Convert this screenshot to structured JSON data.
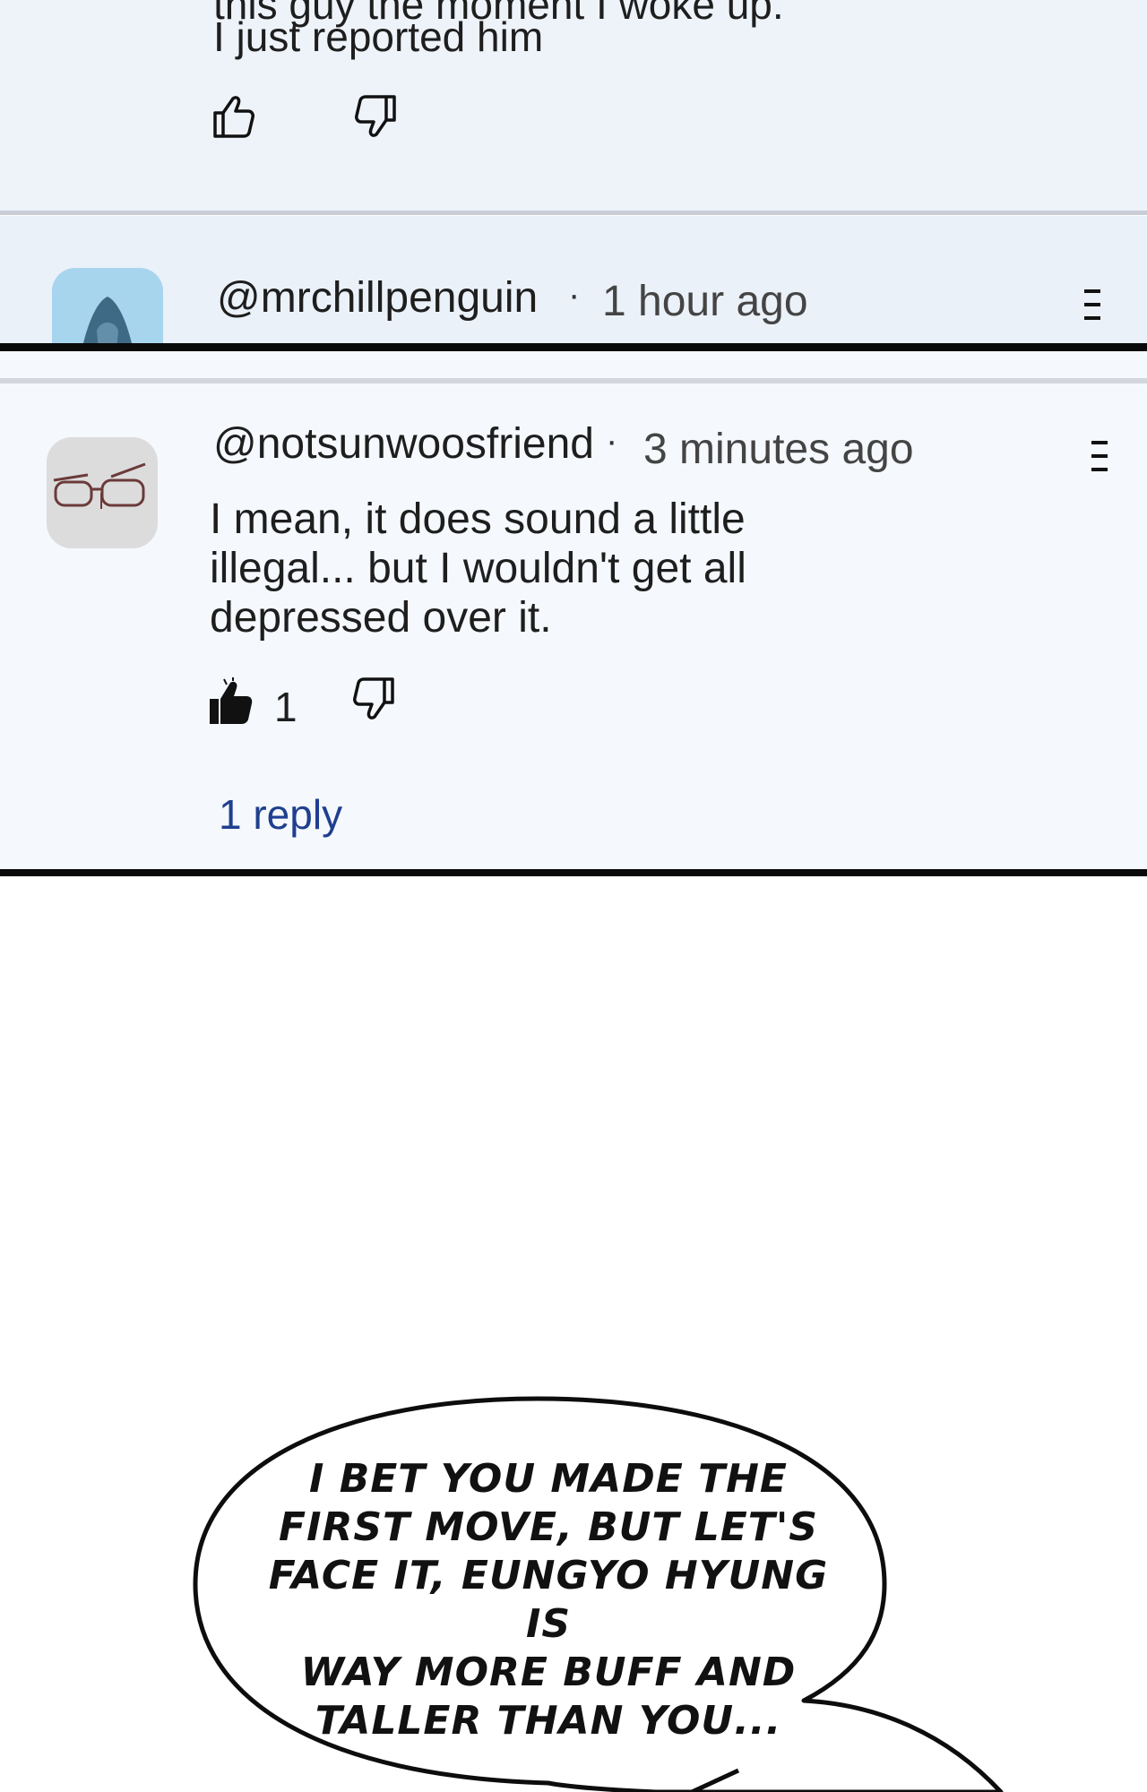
{
  "panel_top": {
    "cut_line": "this guy the moment I woke up.",
    "body": "I just reported him",
    "icons": {
      "like": "thumbs-up-outline-icon",
      "dislike": "thumbs-down-outline-icon"
    }
  },
  "panel_mid": {
    "handle": "@mrchillpenguin",
    "separator": "·",
    "time": "1 hour ago",
    "icons": {
      "avatar": "penguin-avatar-icon",
      "menu": "more-menu-icon"
    }
  },
  "panel_main": {
    "handle": "@notsunwoosfriend",
    "separator": "·",
    "time": "3 minutes ago",
    "comment": "I mean, it does sound a little illegal... but I wouldn't get all depressed over it.",
    "like_count": "1",
    "replies_label": "1 reply",
    "icons": {
      "avatar": "glasses-avatar-icon",
      "like": "thumbs-up-filled-icon",
      "dislike": "thumbs-down-outline-icon",
      "menu": "more-menu-icon"
    },
    "colors": {
      "reply_link": "#1f3f8f"
    }
  },
  "bubble": {
    "text": "I BET YOU MADE THE\nFIRST MOVE, BUT LET'S\nFACE IT, EUNGYO HYUNG IS\nWAY MORE BUFF AND\nTALLER THAN YOU..."
  }
}
